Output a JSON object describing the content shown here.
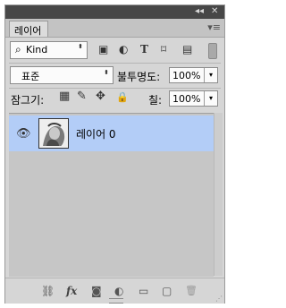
{
  "window": {
    "collapse_icon": "◂◂",
    "close_icon": "✕"
  },
  "tab": {
    "label": "레이어"
  },
  "panel_menu_icon": "▾≡",
  "filter": {
    "kind_label": "Kind",
    "search_icon": "⌕",
    "stepper_icon": "⬍",
    "icons": {
      "image": "▣",
      "adjustment": "◐",
      "type": "T",
      "shape": "⌑",
      "smart": "▤"
    }
  },
  "blend": {
    "mode": "표준",
    "opacity_label": "불투명도:",
    "opacity_value": "100%"
  },
  "lock": {
    "label": "잠그기:",
    "icons": {
      "transparent": "▦",
      "paint": "✎",
      "move": "✥",
      "all": "🔒"
    },
    "fill_label": "칠:",
    "fill_value": "100%"
  },
  "dropdown_arrow": "▾",
  "layers": [
    {
      "name": "레이어 0",
      "visible": true,
      "selected": true,
      "eye_icon": "👁"
    }
  ],
  "footer": {
    "icons": {
      "link": "⛓",
      "fx": "fx",
      "mask": "◙",
      "adjustment": "◐",
      "group": "▭",
      "new_layer": "▢",
      "delete": "🗑"
    }
  },
  "colors": {
    "selected_row": "#b3cdf7",
    "panel_bg": "#d6d6d6",
    "list_bg": "#c6c6c6"
  }
}
